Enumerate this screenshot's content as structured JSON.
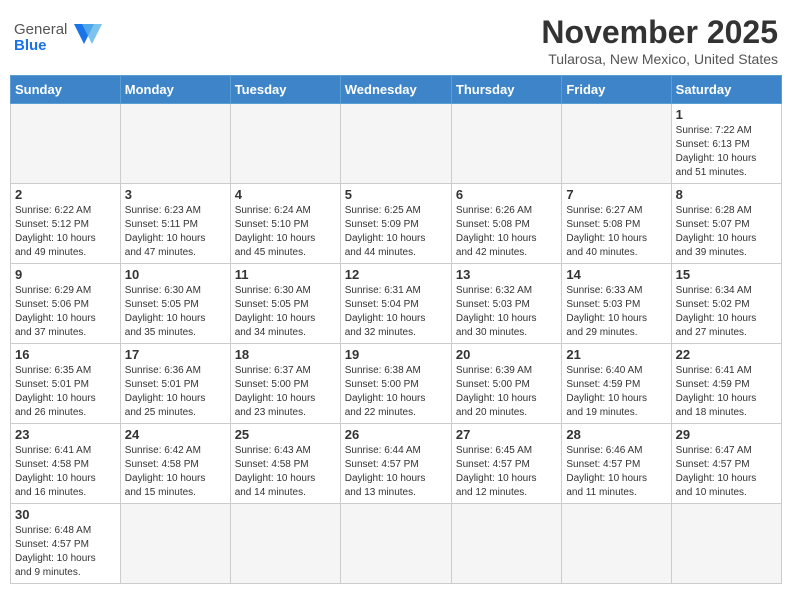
{
  "header": {
    "logo_general": "General",
    "logo_blue": "Blue",
    "month": "November 2025",
    "location": "Tularosa, New Mexico, United States"
  },
  "weekdays": [
    "Sunday",
    "Monday",
    "Tuesday",
    "Wednesday",
    "Thursday",
    "Friday",
    "Saturday"
  ],
  "weeks": [
    [
      {
        "day": "",
        "info": ""
      },
      {
        "day": "",
        "info": ""
      },
      {
        "day": "",
        "info": ""
      },
      {
        "day": "",
        "info": ""
      },
      {
        "day": "",
        "info": ""
      },
      {
        "day": "",
        "info": ""
      },
      {
        "day": "1",
        "info": "Sunrise: 7:22 AM\nSunset: 6:13 PM\nDaylight: 10 hours\nand 51 minutes."
      }
    ],
    [
      {
        "day": "2",
        "info": "Sunrise: 6:22 AM\nSunset: 5:12 PM\nDaylight: 10 hours\nand 49 minutes."
      },
      {
        "day": "3",
        "info": "Sunrise: 6:23 AM\nSunset: 5:11 PM\nDaylight: 10 hours\nand 47 minutes."
      },
      {
        "day": "4",
        "info": "Sunrise: 6:24 AM\nSunset: 5:10 PM\nDaylight: 10 hours\nand 45 minutes."
      },
      {
        "day": "5",
        "info": "Sunrise: 6:25 AM\nSunset: 5:09 PM\nDaylight: 10 hours\nand 44 minutes."
      },
      {
        "day": "6",
        "info": "Sunrise: 6:26 AM\nSunset: 5:08 PM\nDaylight: 10 hours\nand 42 minutes."
      },
      {
        "day": "7",
        "info": "Sunrise: 6:27 AM\nSunset: 5:08 PM\nDaylight: 10 hours\nand 40 minutes."
      },
      {
        "day": "8",
        "info": "Sunrise: 6:28 AM\nSunset: 5:07 PM\nDaylight: 10 hours\nand 39 minutes."
      }
    ],
    [
      {
        "day": "9",
        "info": "Sunrise: 6:29 AM\nSunset: 5:06 PM\nDaylight: 10 hours\nand 37 minutes."
      },
      {
        "day": "10",
        "info": "Sunrise: 6:30 AM\nSunset: 5:05 PM\nDaylight: 10 hours\nand 35 minutes."
      },
      {
        "day": "11",
        "info": "Sunrise: 6:30 AM\nSunset: 5:05 PM\nDaylight: 10 hours\nand 34 minutes."
      },
      {
        "day": "12",
        "info": "Sunrise: 6:31 AM\nSunset: 5:04 PM\nDaylight: 10 hours\nand 32 minutes."
      },
      {
        "day": "13",
        "info": "Sunrise: 6:32 AM\nSunset: 5:03 PM\nDaylight: 10 hours\nand 30 minutes."
      },
      {
        "day": "14",
        "info": "Sunrise: 6:33 AM\nSunset: 5:03 PM\nDaylight: 10 hours\nand 29 minutes."
      },
      {
        "day": "15",
        "info": "Sunrise: 6:34 AM\nSunset: 5:02 PM\nDaylight: 10 hours\nand 27 minutes."
      }
    ],
    [
      {
        "day": "16",
        "info": "Sunrise: 6:35 AM\nSunset: 5:01 PM\nDaylight: 10 hours\nand 26 minutes."
      },
      {
        "day": "17",
        "info": "Sunrise: 6:36 AM\nSunset: 5:01 PM\nDaylight: 10 hours\nand 25 minutes."
      },
      {
        "day": "18",
        "info": "Sunrise: 6:37 AM\nSunset: 5:00 PM\nDaylight: 10 hours\nand 23 minutes."
      },
      {
        "day": "19",
        "info": "Sunrise: 6:38 AM\nSunset: 5:00 PM\nDaylight: 10 hours\nand 22 minutes."
      },
      {
        "day": "20",
        "info": "Sunrise: 6:39 AM\nSunset: 5:00 PM\nDaylight: 10 hours\nand 20 minutes."
      },
      {
        "day": "21",
        "info": "Sunrise: 6:40 AM\nSunset: 4:59 PM\nDaylight: 10 hours\nand 19 minutes."
      },
      {
        "day": "22",
        "info": "Sunrise: 6:41 AM\nSunset: 4:59 PM\nDaylight: 10 hours\nand 18 minutes."
      }
    ],
    [
      {
        "day": "23",
        "info": "Sunrise: 6:41 AM\nSunset: 4:58 PM\nDaylight: 10 hours\nand 16 minutes."
      },
      {
        "day": "24",
        "info": "Sunrise: 6:42 AM\nSunset: 4:58 PM\nDaylight: 10 hours\nand 15 minutes."
      },
      {
        "day": "25",
        "info": "Sunrise: 6:43 AM\nSunset: 4:58 PM\nDaylight: 10 hours\nand 14 minutes."
      },
      {
        "day": "26",
        "info": "Sunrise: 6:44 AM\nSunset: 4:57 PM\nDaylight: 10 hours\nand 13 minutes."
      },
      {
        "day": "27",
        "info": "Sunrise: 6:45 AM\nSunset: 4:57 PM\nDaylight: 10 hours\nand 12 minutes."
      },
      {
        "day": "28",
        "info": "Sunrise: 6:46 AM\nSunset: 4:57 PM\nDaylight: 10 hours\nand 11 minutes."
      },
      {
        "day": "29",
        "info": "Sunrise: 6:47 AM\nSunset: 4:57 PM\nDaylight: 10 hours\nand 10 minutes."
      }
    ],
    [
      {
        "day": "30",
        "info": "Sunrise: 6:48 AM\nSunset: 4:57 PM\nDaylight: 10 hours\nand 9 minutes."
      },
      {
        "day": "",
        "info": ""
      },
      {
        "day": "",
        "info": ""
      },
      {
        "day": "",
        "info": ""
      },
      {
        "day": "",
        "info": ""
      },
      {
        "day": "",
        "info": ""
      },
      {
        "day": "",
        "info": ""
      }
    ]
  ]
}
